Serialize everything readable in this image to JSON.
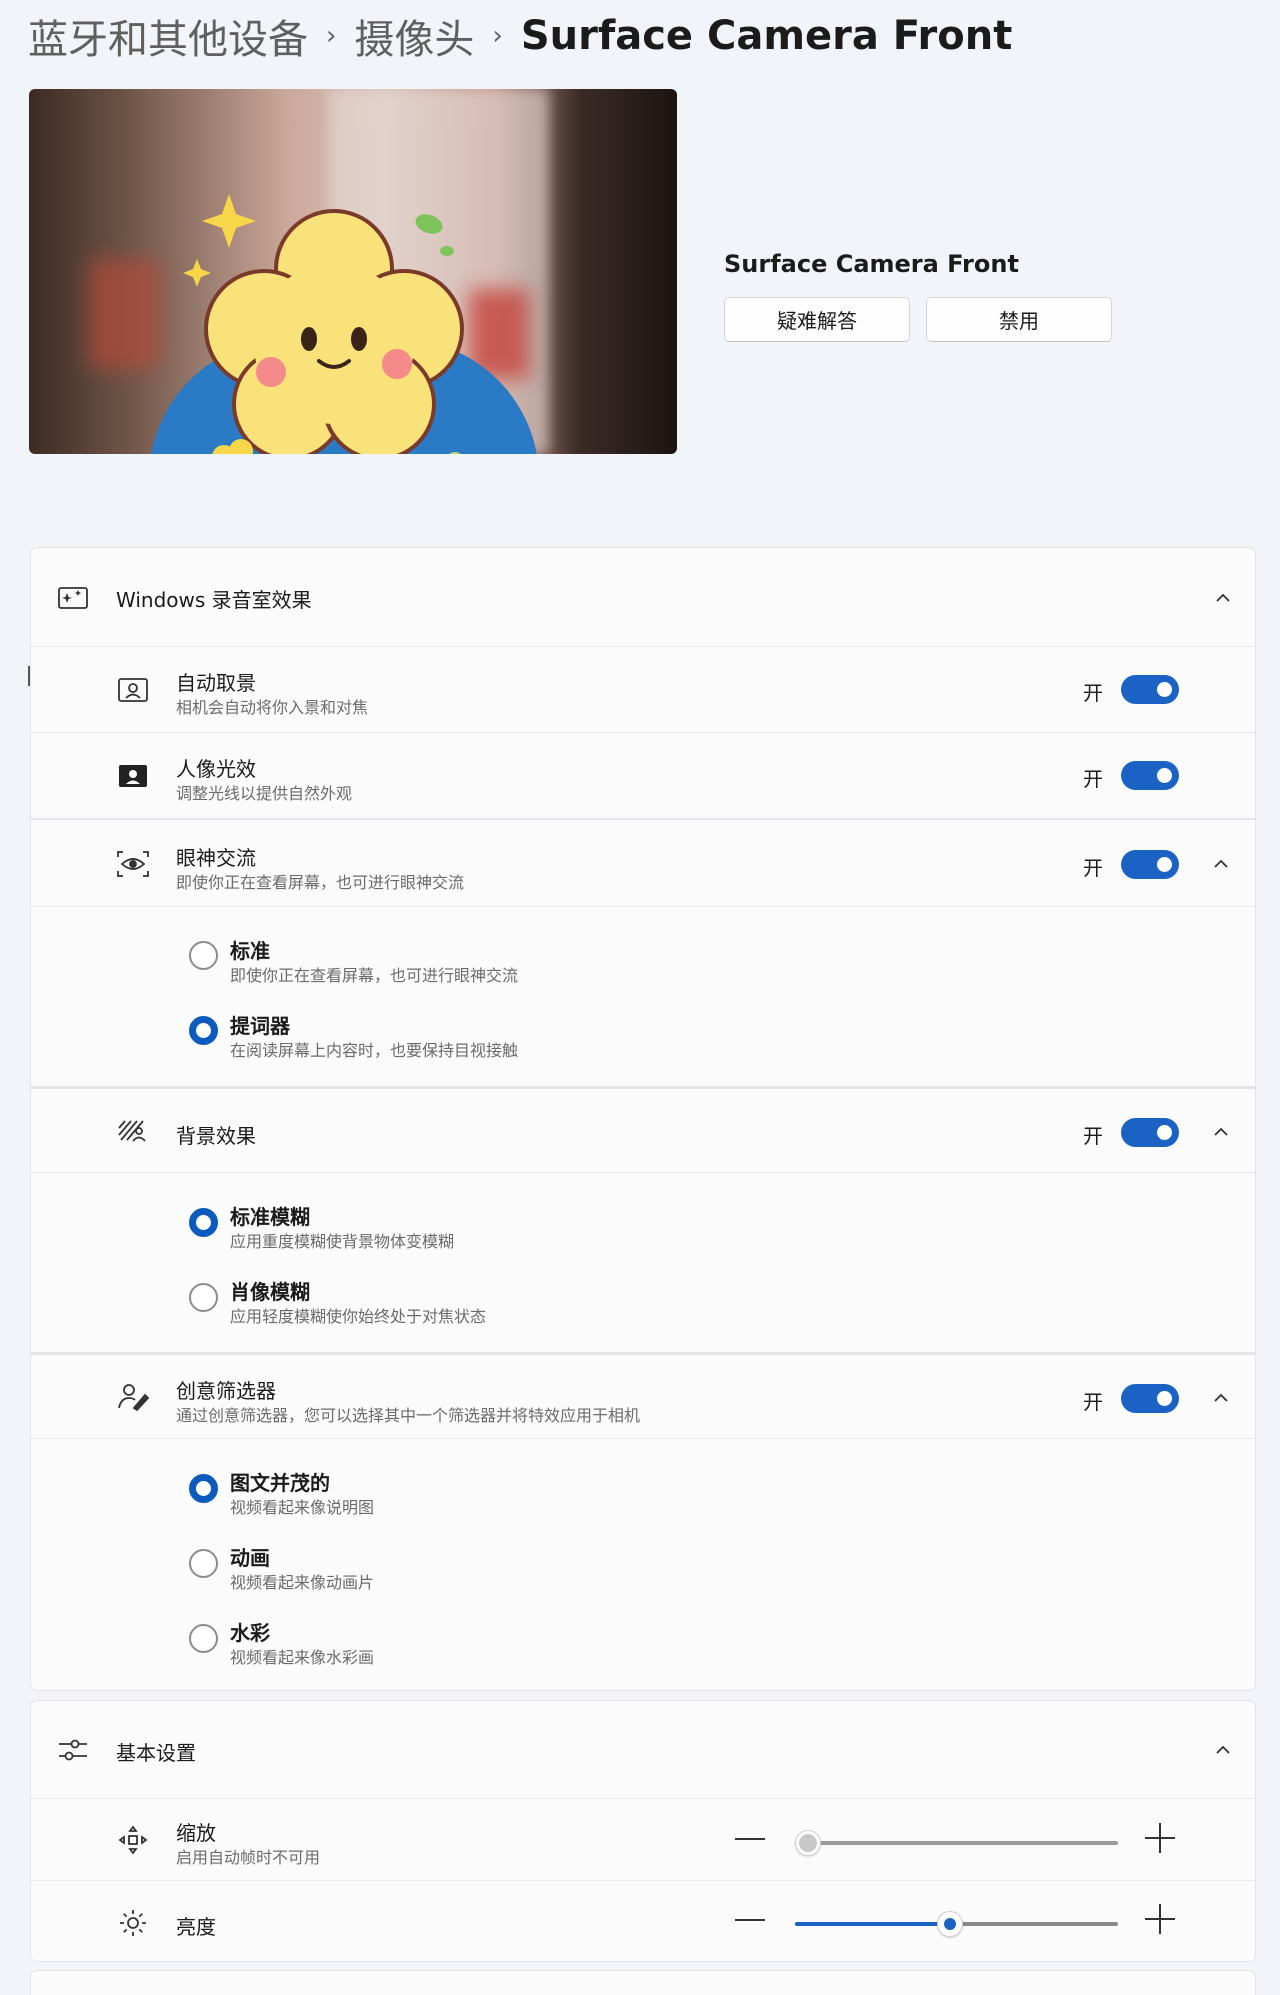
{
  "breadcrumb": {
    "items": [
      "蓝牙和其他设备",
      "摄像头"
    ],
    "current": "Surface Camera Front",
    "separator": "›"
  },
  "device": {
    "name": "Surface Camera Front",
    "troubleshoot_label": "疑难解答",
    "disable_label": "禁用"
  },
  "studio_effects": {
    "header": "Windows 录音室效果",
    "on_label": "开",
    "auto_framing": {
      "title": "自动取景",
      "desc": "相机会自动将你入景和对焦",
      "on": true
    },
    "portrait_light": {
      "title": "人像光效",
      "desc": "调整光线以提供自然外观",
      "on": true
    },
    "eye_contact": {
      "title": "眼神交流",
      "desc": "即使你正在查看屏幕，也可进行眼神交流",
      "on": true,
      "options": [
        {
          "title": "标准",
          "desc": "即使你正在查看屏幕，也可进行眼神交流",
          "selected": false
        },
        {
          "title": "提词器",
          "desc": "在阅读屏幕上内容时，也要保持目视接触",
          "selected": true
        }
      ]
    },
    "background": {
      "title": "背景效果",
      "on": true,
      "options": [
        {
          "title": "标准模糊",
          "desc": "应用重度模糊使背景物体变模糊",
          "selected": true
        },
        {
          "title": "肖像模糊",
          "desc": "应用轻度模糊使你始终处于对焦状态",
          "selected": false
        }
      ]
    },
    "creative_filters": {
      "title": "创意筛选器",
      "desc": "通过创意筛选器，您可以选择其中一个筛选器并将特效应用于相机",
      "on": true,
      "options": [
        {
          "title": "图文并茂的",
          "desc": "视频看起来像说明图",
          "selected": true
        },
        {
          "title": "动画",
          "desc": "视频看起来像动画片",
          "selected": false
        },
        {
          "title": "水彩",
          "desc": "视频看起来像水彩画",
          "selected": false
        }
      ]
    }
  },
  "basic_settings": {
    "header": "基本设置",
    "zoom": {
      "title": "缩放",
      "desc": "启用自动帧时不可用",
      "value_fraction": 0.0,
      "enabled": false
    },
    "brightness": {
      "title": "亮度",
      "value_fraction": 0.48,
      "enabled": true
    }
  },
  "colors": {
    "accent": "#1a63c4",
    "background": "#f1f4f9",
    "card": "#fbfbfc"
  }
}
